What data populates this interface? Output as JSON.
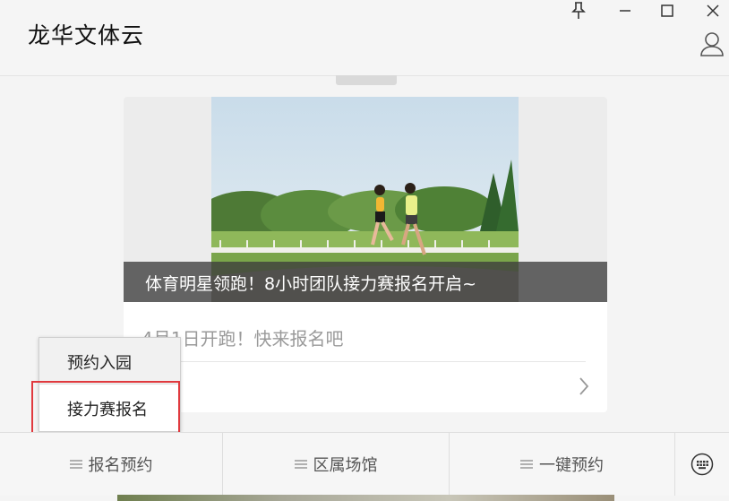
{
  "app": {
    "title": "龙华文体云"
  },
  "window_controls": {
    "pin_icon": "pin-icon",
    "minimize_icon": "minimize-icon",
    "maximize_icon": "maximize-icon",
    "close_icon": "close-icon",
    "user_icon": "user-icon"
  },
  "card": {
    "banner_caption": "体育明星领跑！8小时团队接力赛报名开启~",
    "subtitle": "4月1日开跑！快来报名吧",
    "chevron_icon": "chevron-right-icon"
  },
  "popup_menu": {
    "items": [
      {
        "label": "预约入园"
      },
      {
        "label": "接力赛报名"
      }
    ]
  },
  "tabbar": {
    "tabs": [
      {
        "label": "报名预约"
      },
      {
        "label": "区属场馆"
      },
      {
        "label": "一键预约"
      }
    ],
    "keyboard_icon": "keyboard-icon"
  },
  "colors": {
    "highlight_border": "#e0393e",
    "caption_overlay": "#3c3c3c",
    "subtitle_text": "#9a9a9a"
  }
}
